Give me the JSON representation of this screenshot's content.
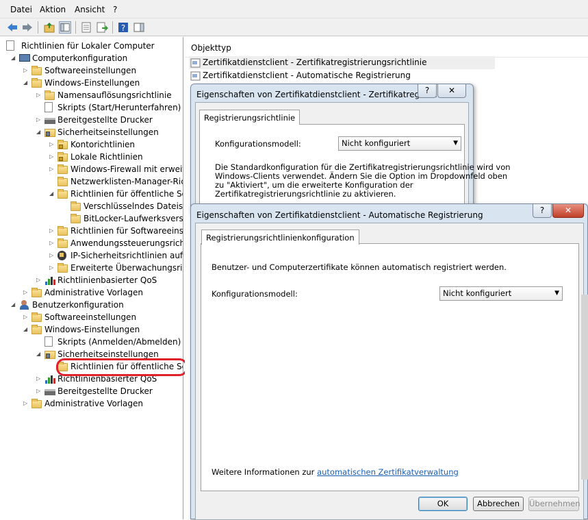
{
  "menu": [
    "Datei",
    "Aktion",
    "Ansicht",
    "?"
  ],
  "tree": [
    {
      "label": "Richtlinien für Lokaler Computer",
      "icon": "policy-doc-icon",
      "arrow": ""
    },
    {
      "label": "Computerkonfiguration",
      "icon": "computer-icon",
      "arrow": "open"
    },
    {
      "label": "Softwareeinstellungen",
      "icon": "folder-icon",
      "arrow": "closed"
    },
    {
      "label": "Windows-Einstellungen",
      "icon": "folder-icon",
      "arrow": "open"
    },
    {
      "label": "Namensauflösungsrichtlinie",
      "icon": "folder-icon",
      "arrow": "closed"
    },
    {
      "label": "Skripts (Start/Herunterfahren)",
      "icon": "script-icon",
      "arrow": ""
    },
    {
      "label": "Bereitgestellte Drucker",
      "icon": "printer-icon",
      "arrow": "closed"
    },
    {
      "label": "Sicherheitseinstellungen",
      "icon": "security-icon",
      "arrow": "open"
    },
    {
      "label": "Kontorichtlinien",
      "icon": "locked-folder-icon",
      "arrow": "closed"
    },
    {
      "label": "Lokale Richtlinien",
      "icon": "locked-folder-icon",
      "arrow": "closed"
    },
    {
      "label": "Windows-Firewall mit erweiter",
      "icon": "folder-icon",
      "arrow": "closed"
    },
    {
      "label": "Netzwerklisten-Manager-Richt",
      "icon": "folder-icon",
      "arrow": ""
    },
    {
      "label": "Richtlinien für öffentliche Schl",
      "icon": "folder-icon",
      "arrow": "open"
    },
    {
      "label": "Verschlüsselndes Dateisyst",
      "icon": "folder-icon",
      "arrow": ""
    },
    {
      "label": "BitLocker-Laufwerksversch",
      "icon": "folder-icon",
      "arrow": ""
    },
    {
      "label": "Richtlinien für Softwareeinschi",
      "icon": "folder-icon",
      "arrow": "closed"
    },
    {
      "label": "Anwendungssteuerungsrichtli",
      "icon": "folder-icon",
      "arrow": "closed"
    },
    {
      "label": "IP-Sicherheitsrichtlinien auf Lc",
      "icon": "ipsec-icon",
      "arrow": "closed"
    },
    {
      "label": "Erweiterte Überwachungsricht",
      "icon": "folder-icon",
      "arrow": "closed"
    },
    {
      "label": "Richtlinienbasierter QoS",
      "icon": "qos-chart-icon",
      "arrow": "closed"
    },
    {
      "label": "Administrative Vorlagen",
      "icon": "folder-icon",
      "arrow": "closed"
    },
    {
      "label": "Benutzerkonfiguration",
      "icon": "users-icon",
      "arrow": "open"
    },
    {
      "label": "Softwareeinstellungen",
      "icon": "folder-icon",
      "arrow": "closed"
    },
    {
      "label": "Windows-Einstellungen",
      "icon": "folder-icon",
      "arrow": "open"
    },
    {
      "label": "Skripts (Anmelden/Abmelden)",
      "icon": "script-icon",
      "arrow": ""
    },
    {
      "label": "Sicherheitseinstellungen",
      "icon": "security-icon",
      "arrow": "open"
    },
    {
      "label": "Richtlinien für öffentliche Schl",
      "icon": "folder-icon",
      "arrow": ""
    },
    {
      "label": "Richtlinienbasierter QoS",
      "icon": "qos-chart-icon",
      "arrow": "closed"
    },
    {
      "label": "Bereitgestellte Drucker",
      "icon": "printer-icon",
      "arrow": "closed"
    },
    {
      "label": "Administrative Vorlagen",
      "icon": "folder-icon",
      "arrow": "closed"
    }
  ],
  "list": {
    "column": "Objekttyp",
    "rows": [
      "Zertifikatdienstclient - Zertifikatregistrierungsrichtlinie",
      "Zertifikatdienstclient - Automatische Registrierung"
    ]
  },
  "dialog1": {
    "title": "Eigenschaften von Zertifikatdienstclient - Zertifikatregistr...",
    "help": "?",
    "close": "✕",
    "tab": "Registrierungsrichtlinie",
    "model_label": "Konfigurationsmodell:",
    "model_value": "Nicht konfiguriert",
    "desc": [
      "Die Standardkonfiguration für die Zertifikatregistrierungsrichtlinie wird von",
      "Windows-Clients verwendet. Ändern Sie die Option im Dropdownfeld oben",
      "zu \"Aktiviert\", um die erweiterte Konfiguration der",
      "Zertifikatregistrierungsrichtlinie zu aktivieren."
    ]
  },
  "dialog2": {
    "title": "Eigenschaften von Zertifikatdienstclient - Automatische Registrierung",
    "help": "?",
    "close": "✕",
    "tab": "Registrierungsrichtlinienkonfiguration",
    "info": "Benutzer- und Computerzertifikate können automatisch registriert werden.",
    "model_label": "Konfigurationsmodell:",
    "model_value": "Nicht konfiguriert",
    "more_prefix": "Weitere Informationen zur ",
    "more_link": "automatischen Zertifikatverwaltung",
    "ok": "OK",
    "cancel": "Abbrechen",
    "apply": "Übernehmen"
  },
  "colors": {
    "highlight": "#e0202a",
    "link": "#1a5fb4"
  }
}
